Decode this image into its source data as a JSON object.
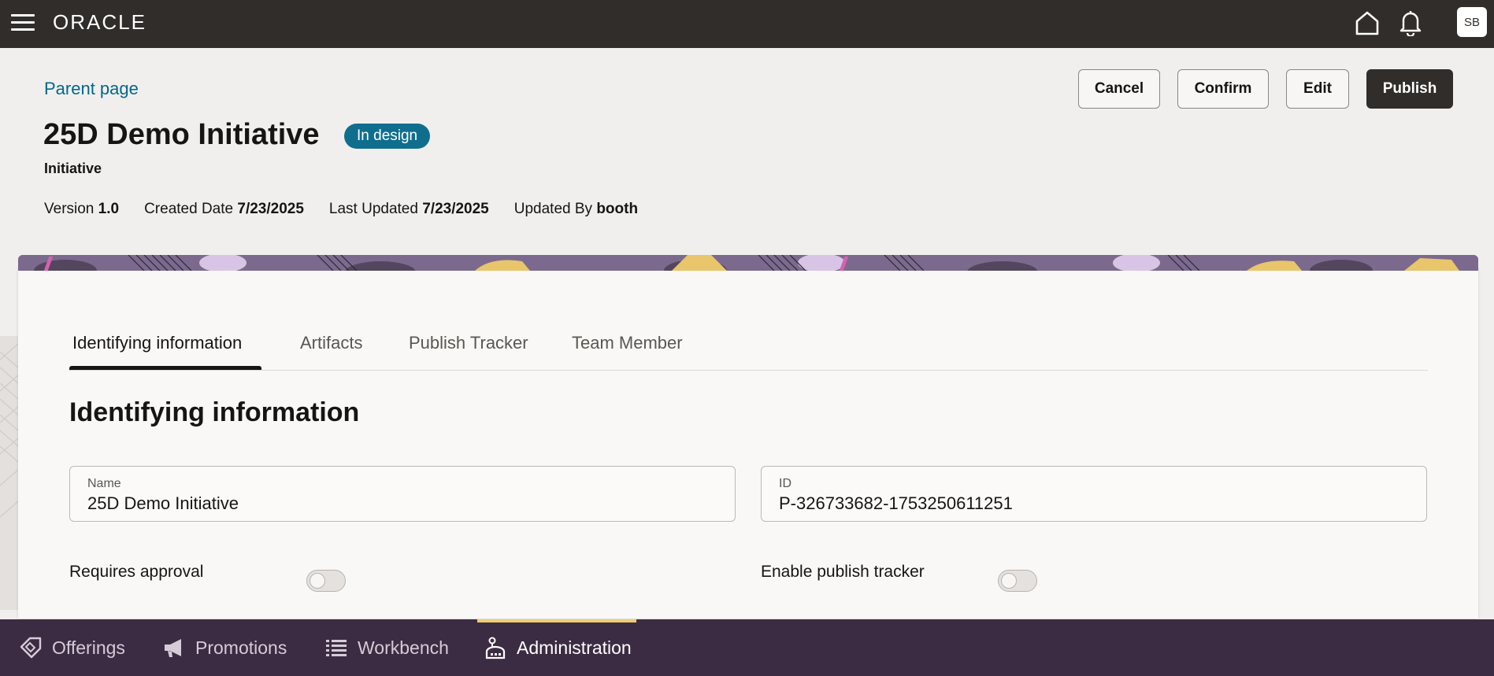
{
  "topbar": {
    "logo": "ORACLE",
    "avatar_initials": "SB",
    "icons": [
      "menu-icon",
      "home-icon",
      "bell-icon"
    ]
  },
  "header": {
    "parent_link": "Parent page",
    "title": "25D Demo Initiative",
    "status_badge": "In design",
    "subtitle": "Initiative",
    "meta": {
      "version_label": "Version",
      "version_value": "1.0",
      "created_label": "Created Date",
      "created_value": "7/23/2025",
      "updated_label": "Last Updated",
      "updated_value": "7/23/2025",
      "updated_by_label": "Updated By",
      "updated_by_value": "booth"
    },
    "buttons": {
      "cancel": "Cancel",
      "confirm": "Confirm",
      "edit": "Edit",
      "publish": "Publish"
    }
  },
  "tabs": [
    {
      "label": "Identifying information",
      "active": true
    },
    {
      "label": "Artifacts",
      "active": false
    },
    {
      "label": "Publish Tracker",
      "active": false
    },
    {
      "label": "Team Member",
      "active": false
    }
  ],
  "section": {
    "title": "Identifying information",
    "fields": {
      "name": {
        "label": "Name",
        "value": "25D Demo Initiative"
      },
      "id": {
        "label": "ID",
        "value": "P-326733682-1753250611251"
      }
    },
    "toggles": {
      "requires_approval": {
        "label": "Requires approval",
        "on": false
      },
      "enable_publish_tracker": {
        "label": "Enable publish tracker",
        "on": false
      }
    }
  },
  "bottom_nav": [
    {
      "label": "Offerings",
      "icon": "tag-icon",
      "active": false
    },
    {
      "label": "Promotions",
      "icon": "megaphone-icon",
      "active": false
    },
    {
      "label": "Workbench",
      "icon": "list-icon",
      "active": false
    },
    {
      "label": "Administration",
      "icon": "admin-icon",
      "active": true
    }
  ],
  "colors": {
    "topbar": "#312d2a",
    "link": "#00688c",
    "badge": "#0f6e8e",
    "bottom_nav": "#3c2c43",
    "active_indicator": "#f0cc71"
  }
}
